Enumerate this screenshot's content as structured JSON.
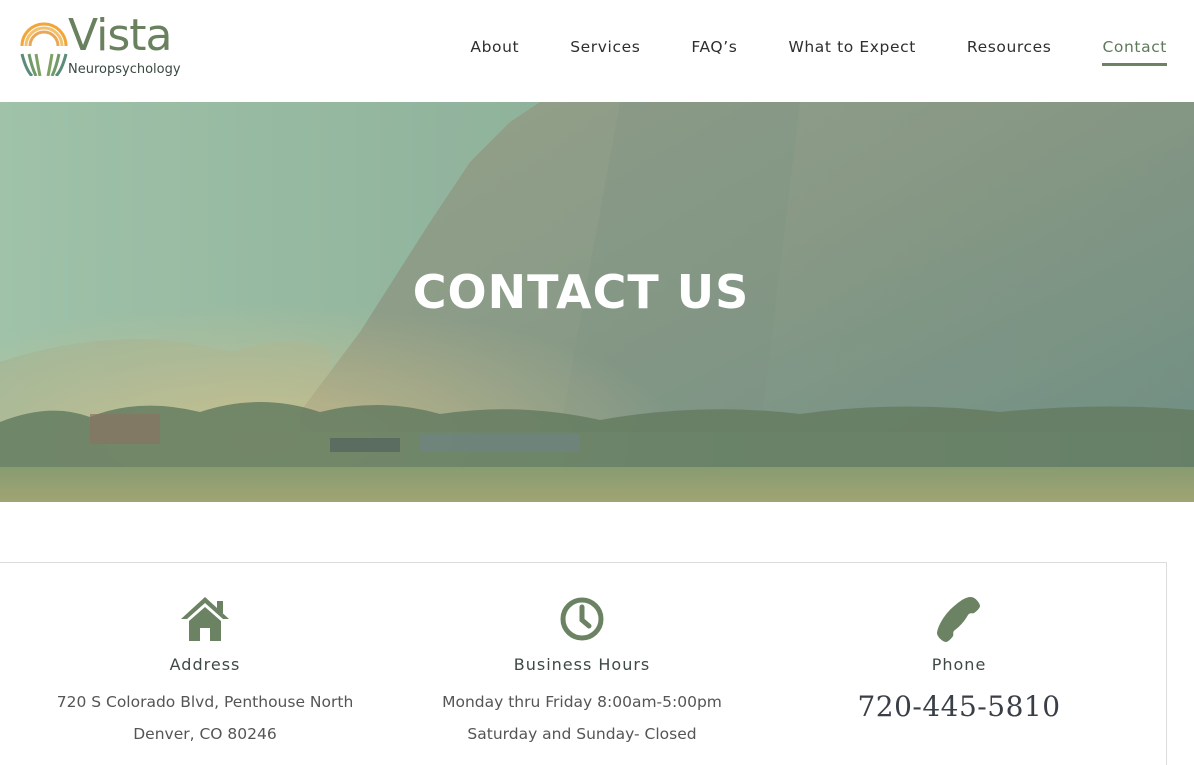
{
  "logo": {
    "word": "Vista",
    "sub": "Neuropsychology"
  },
  "nav": {
    "items": [
      {
        "label": "About"
      },
      {
        "label": "Services"
      },
      {
        "label": "FAQ’s"
      },
      {
        "label": "What to Expect"
      },
      {
        "label": "Resources"
      },
      {
        "label": "Contact"
      }
    ],
    "active": "Contact"
  },
  "hero": {
    "title": "CONTACT US"
  },
  "info": {
    "address": {
      "icon": "home-icon",
      "heading": "Address",
      "line1": "720 S Colorado Blvd, Penthouse North",
      "line2": "Denver, CO 80246"
    },
    "hours": {
      "icon": "clock-icon",
      "heading": "Business Hours",
      "line1": "Monday thru Friday 8:00am-5:00pm",
      "line2": "Saturday and Sunday- Closed"
    },
    "phone": {
      "icon": "phone-icon",
      "heading": "Phone",
      "number": "720-445-5810"
    }
  },
  "colors": {
    "brand_green": "#6b8263",
    "text_dark": "#2f2f2f",
    "white": "#ffffff"
  }
}
